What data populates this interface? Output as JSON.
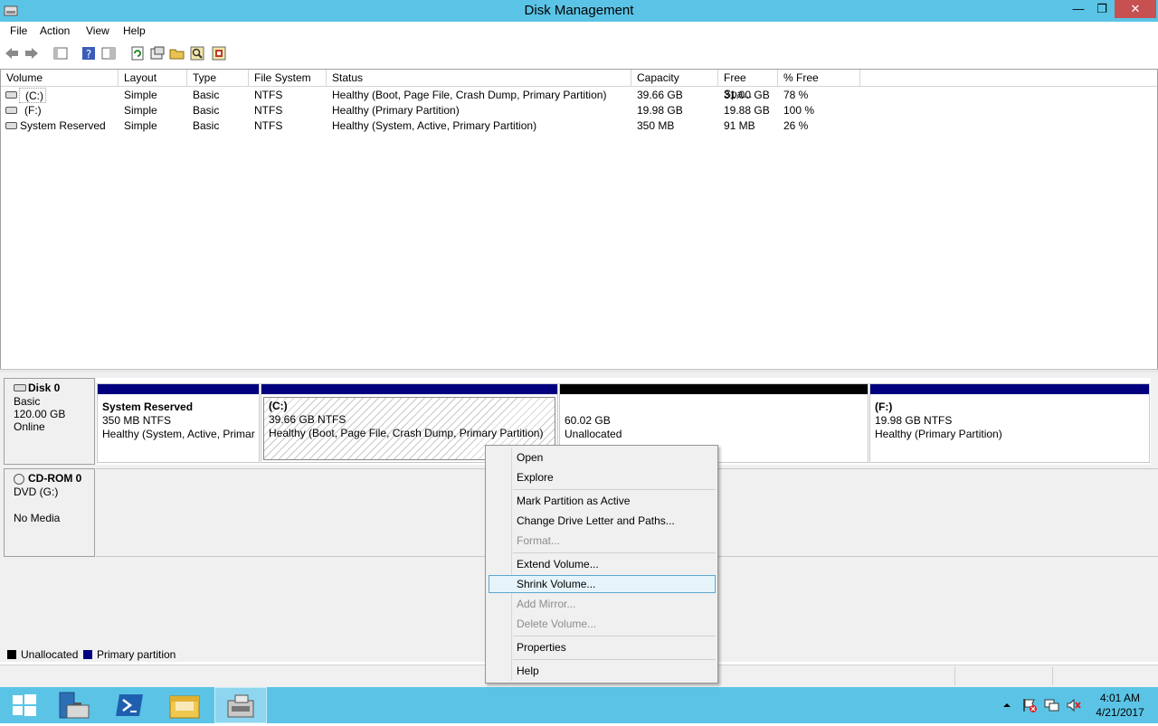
{
  "window": {
    "title": "Disk Management",
    "min": "—",
    "max": "❐",
    "close": "✕"
  },
  "menus": [
    "File",
    "Action",
    "View",
    "Help"
  ],
  "columns": [
    "Volume",
    "Layout",
    "Type",
    "File System",
    "Status",
    "Capacity",
    "Free Spa...",
    "% Free"
  ],
  "volumes": [
    {
      "volume": "(C:)",
      "layout": "Simple",
      "type": "Basic",
      "fs": "NTFS",
      "status": "Healthy (Boot, Page File, Crash Dump, Primary Partition)",
      "capacity": "39.66 GB",
      "free": "31.00 GB",
      "pct": "78 %"
    },
    {
      "volume": "(F:)",
      "layout": "Simple",
      "type": "Basic",
      "fs": "NTFS",
      "status": "Healthy (Primary Partition)",
      "capacity": "19.98 GB",
      "free": "19.88 GB",
      "pct": "100 %"
    },
    {
      "volume": "System Reserved",
      "layout": "Simple",
      "type": "Basic",
      "fs": "NTFS",
      "status": "Healthy (System, Active, Primary Partition)",
      "capacity": "350 MB",
      "free": "91 MB",
      "pct": "26 %"
    }
  ],
  "disk0": {
    "name": "Disk 0",
    "type": "Basic",
    "size": "120.00 GB",
    "state": "Online",
    "parts": [
      {
        "title": "System Reserved",
        "size": "350 MB NTFS",
        "status": "Healthy (System, Active, Primar"
      },
      {
        "title": "(C:)",
        "size": "39.66 GB NTFS",
        "status": "Healthy (Boot, Page File, Crash Dump, Primary Partition)"
      },
      {
        "title": "",
        "size": "60.02 GB",
        "status": "Unallocated"
      },
      {
        "title": "(F:)",
        "size": "19.98 GB NTFS",
        "status": "Healthy (Primary Partition)"
      }
    ]
  },
  "cdrom": {
    "name": "CD-ROM 0",
    "type": "DVD (G:)",
    "state": "No Media"
  },
  "legend": {
    "unallocated": "Unallocated",
    "primary": "Primary partition"
  },
  "colors": {
    "primary": "#00007f",
    "unallocated": "#000000",
    "titlebar": "#5bc4e6"
  },
  "context_menu": {
    "open": "Open",
    "explore": "Explore",
    "mark_active": "Mark Partition as Active",
    "change_letter": "Change Drive Letter and Paths...",
    "format": "Format...",
    "extend": "Extend Volume...",
    "shrink": "Shrink Volume...",
    "add_mirror": "Add Mirror...",
    "delete": "Delete Volume...",
    "properties": "Properties",
    "help": "Help"
  },
  "clock": {
    "time": "4:01 AM",
    "date": "4/21/2017"
  }
}
